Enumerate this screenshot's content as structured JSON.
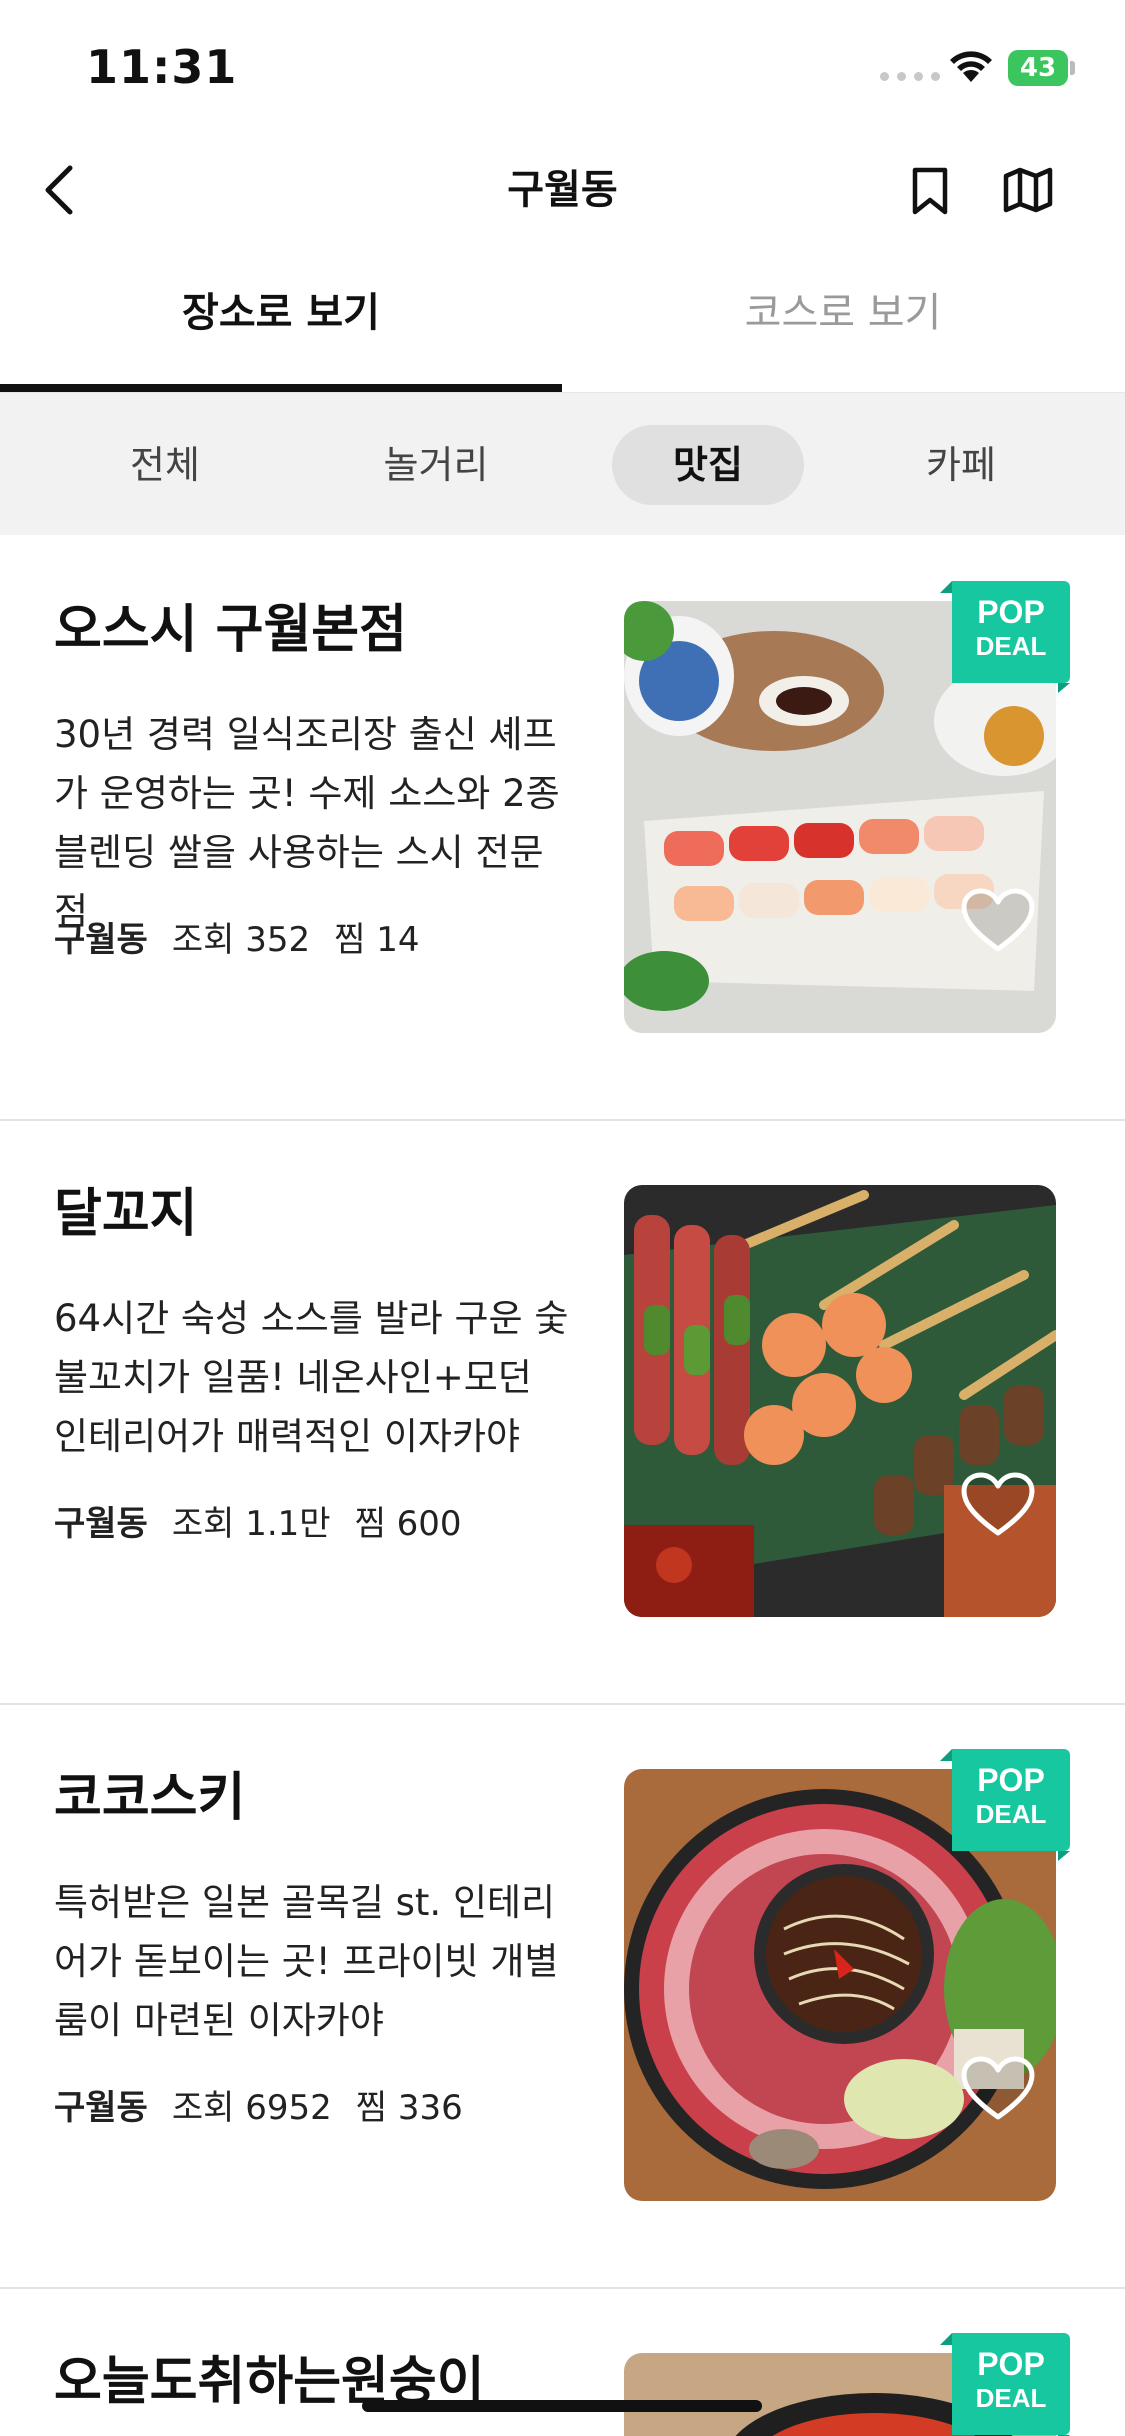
{
  "status_bar": {
    "time": "11:31",
    "battery": "43"
  },
  "nav": {
    "title": "구월동",
    "back_icon": "chevron-left-icon",
    "bookmark_icon": "bookmark-icon",
    "map_icon": "map-icon"
  },
  "view_tabs": [
    {
      "label": "장소로 보기",
      "active": true
    },
    {
      "label": "코스로 보기",
      "active": false
    }
  ],
  "categories": [
    {
      "label": "전체",
      "selected": false
    },
    {
      "label": "놀거리",
      "selected": false
    },
    {
      "label": "맛집",
      "selected": true
    },
    {
      "label": "카페",
      "selected": false
    }
  ],
  "places": [
    {
      "name": "오스시 구월본점",
      "description": "30년 경력 일식조리장 출신 셰프가 운영하는 곳! 수제 소스와 2종 블렌딩 쌀을 사용하는 스시 전문점",
      "location": "구월동",
      "views": "조회 352",
      "likes": "찜 14",
      "badge": {
        "line1": "POP",
        "line2": "DEAL"
      },
      "accent": "#16c7a0"
    },
    {
      "name": "달꼬지",
      "description": "64시간 숙성 소스를 발라 구운 숯불꼬치가 일품! 네온사인+모던 인테리어가 매력적인 이자카야",
      "location": "구월동",
      "views": "조회 1.1만",
      "likes": "찜 600"
    },
    {
      "name": "코코스키",
      "description": "특허받은 일본 골목길 st. 인테리어가 돋보이는 곳! 프라이빗 개별룸이 마련된 이자카야",
      "location": "구월동",
      "views": "조회 6952",
      "likes": "찜 336",
      "badge": {
        "line1": "POP",
        "line2": "DEAL"
      }
    },
    {
      "name": "오늘도취하는원숭이",
      "badge": {
        "line1": "POP",
        "line2": "DEAL"
      }
    }
  ]
}
